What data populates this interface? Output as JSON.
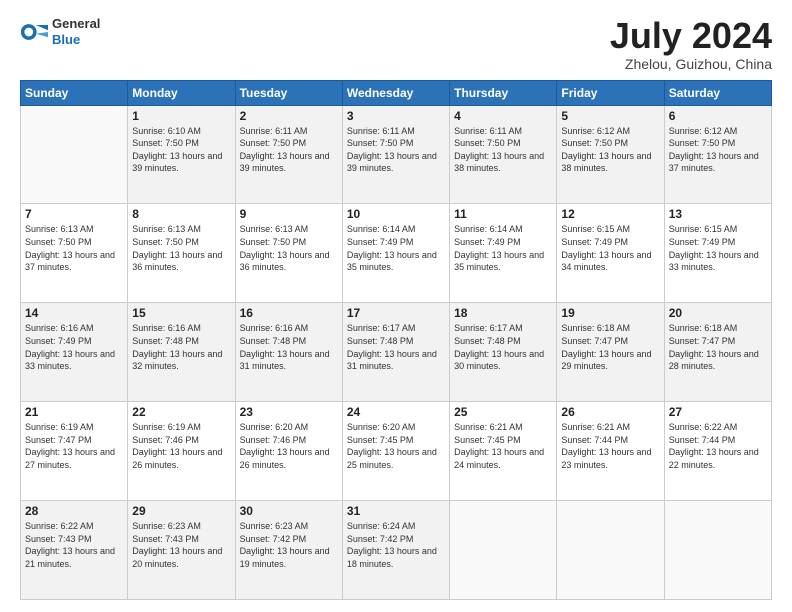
{
  "header": {
    "logo_general": "General",
    "logo_blue": "Blue",
    "title": "July 2024",
    "location": "Zhelou, Guizhou, China"
  },
  "days_of_week": [
    "Sunday",
    "Monday",
    "Tuesday",
    "Wednesday",
    "Thursday",
    "Friday",
    "Saturday"
  ],
  "weeks": [
    [
      {
        "day": "",
        "sunrise": "",
        "sunset": "",
        "daylight": ""
      },
      {
        "day": "1",
        "sunrise": "6:10 AM",
        "sunset": "7:50 PM",
        "daylight": "13 hours and 39 minutes."
      },
      {
        "day": "2",
        "sunrise": "6:11 AM",
        "sunset": "7:50 PM",
        "daylight": "13 hours and 39 minutes."
      },
      {
        "day": "3",
        "sunrise": "6:11 AM",
        "sunset": "7:50 PM",
        "daylight": "13 hours and 39 minutes."
      },
      {
        "day": "4",
        "sunrise": "6:11 AM",
        "sunset": "7:50 PM",
        "daylight": "13 hours and 38 minutes."
      },
      {
        "day": "5",
        "sunrise": "6:12 AM",
        "sunset": "7:50 PM",
        "daylight": "13 hours and 38 minutes."
      },
      {
        "day": "6",
        "sunrise": "6:12 AM",
        "sunset": "7:50 PM",
        "daylight": "13 hours and 37 minutes."
      }
    ],
    [
      {
        "day": "7",
        "sunrise": "6:13 AM",
        "sunset": "7:50 PM",
        "daylight": "13 hours and 37 minutes."
      },
      {
        "day": "8",
        "sunrise": "6:13 AM",
        "sunset": "7:50 PM",
        "daylight": "13 hours and 36 minutes."
      },
      {
        "day": "9",
        "sunrise": "6:13 AM",
        "sunset": "7:50 PM",
        "daylight": "13 hours and 36 minutes."
      },
      {
        "day": "10",
        "sunrise": "6:14 AM",
        "sunset": "7:49 PM",
        "daylight": "13 hours and 35 minutes."
      },
      {
        "day": "11",
        "sunrise": "6:14 AM",
        "sunset": "7:49 PM",
        "daylight": "13 hours and 35 minutes."
      },
      {
        "day": "12",
        "sunrise": "6:15 AM",
        "sunset": "7:49 PM",
        "daylight": "13 hours and 34 minutes."
      },
      {
        "day": "13",
        "sunrise": "6:15 AM",
        "sunset": "7:49 PM",
        "daylight": "13 hours and 33 minutes."
      }
    ],
    [
      {
        "day": "14",
        "sunrise": "6:16 AM",
        "sunset": "7:49 PM",
        "daylight": "13 hours and 33 minutes."
      },
      {
        "day": "15",
        "sunrise": "6:16 AM",
        "sunset": "7:48 PM",
        "daylight": "13 hours and 32 minutes."
      },
      {
        "day": "16",
        "sunrise": "6:16 AM",
        "sunset": "7:48 PM",
        "daylight": "13 hours and 31 minutes."
      },
      {
        "day": "17",
        "sunrise": "6:17 AM",
        "sunset": "7:48 PM",
        "daylight": "13 hours and 31 minutes."
      },
      {
        "day": "18",
        "sunrise": "6:17 AM",
        "sunset": "7:48 PM",
        "daylight": "13 hours and 30 minutes."
      },
      {
        "day": "19",
        "sunrise": "6:18 AM",
        "sunset": "7:47 PM",
        "daylight": "13 hours and 29 minutes."
      },
      {
        "day": "20",
        "sunrise": "6:18 AM",
        "sunset": "7:47 PM",
        "daylight": "13 hours and 28 minutes."
      }
    ],
    [
      {
        "day": "21",
        "sunrise": "6:19 AM",
        "sunset": "7:47 PM",
        "daylight": "13 hours and 27 minutes."
      },
      {
        "day": "22",
        "sunrise": "6:19 AM",
        "sunset": "7:46 PM",
        "daylight": "13 hours and 26 minutes."
      },
      {
        "day": "23",
        "sunrise": "6:20 AM",
        "sunset": "7:46 PM",
        "daylight": "13 hours and 26 minutes."
      },
      {
        "day": "24",
        "sunrise": "6:20 AM",
        "sunset": "7:45 PM",
        "daylight": "13 hours and 25 minutes."
      },
      {
        "day": "25",
        "sunrise": "6:21 AM",
        "sunset": "7:45 PM",
        "daylight": "13 hours and 24 minutes."
      },
      {
        "day": "26",
        "sunrise": "6:21 AM",
        "sunset": "7:44 PM",
        "daylight": "13 hours and 23 minutes."
      },
      {
        "day": "27",
        "sunrise": "6:22 AM",
        "sunset": "7:44 PM",
        "daylight": "13 hours and 22 minutes."
      }
    ],
    [
      {
        "day": "28",
        "sunrise": "6:22 AM",
        "sunset": "7:43 PM",
        "daylight": "13 hours and 21 minutes."
      },
      {
        "day": "29",
        "sunrise": "6:23 AM",
        "sunset": "7:43 PM",
        "daylight": "13 hours and 20 minutes."
      },
      {
        "day": "30",
        "sunrise": "6:23 AM",
        "sunset": "7:42 PM",
        "daylight": "13 hours and 19 minutes."
      },
      {
        "day": "31",
        "sunrise": "6:24 AM",
        "sunset": "7:42 PM",
        "daylight": "13 hours and 18 minutes."
      },
      {
        "day": "",
        "sunrise": "",
        "sunset": "",
        "daylight": ""
      },
      {
        "day": "",
        "sunrise": "",
        "sunset": "",
        "daylight": ""
      },
      {
        "day": "",
        "sunrise": "",
        "sunset": "",
        "daylight": ""
      }
    ]
  ],
  "labels": {
    "sunrise_prefix": "Sunrise: ",
    "sunset_prefix": "Sunset: ",
    "daylight_prefix": "Daylight: "
  }
}
